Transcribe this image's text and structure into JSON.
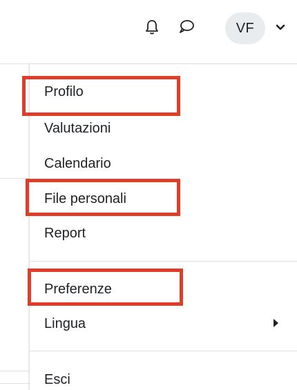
{
  "navbar": {
    "bell_icon": "bell-icon",
    "chat_icon": "chat-bubble-icon",
    "avatar_initials": "VF",
    "caret_icon": "chevron-down-icon"
  },
  "user_menu": {
    "items": [
      {
        "label": "Profilo"
      },
      {
        "label": "Valutazioni"
      },
      {
        "label": "Calendario"
      },
      {
        "label": "File personali"
      },
      {
        "label": "Report"
      },
      {
        "label": "Preferenze"
      },
      {
        "label": "Lingua",
        "has_submenu": true
      },
      {
        "label": "Esci"
      }
    ]
  },
  "colors": {
    "highlight": "#e03c2a",
    "avatar_bg": "#e9ecef",
    "text": "#1d2125"
  }
}
